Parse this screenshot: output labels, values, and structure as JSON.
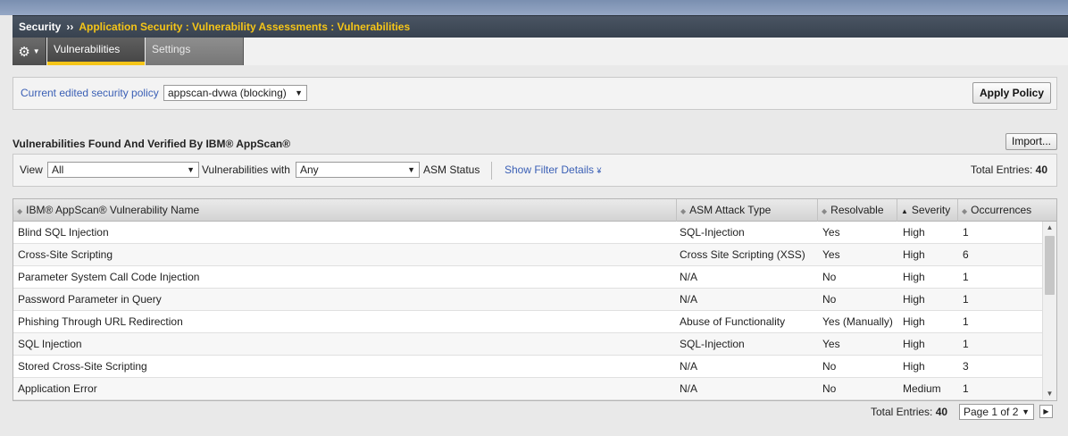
{
  "breadcrumb": {
    "root": "Security",
    "separator": "››",
    "path": "Application Security : Vulnerability Assessments : Vulnerabilities"
  },
  "tabs": [
    {
      "label": "Vulnerabilities",
      "active": true
    },
    {
      "label": "Settings",
      "active": false
    }
  ],
  "policy": {
    "label": "Current edited security policy",
    "selected": "appscan-dvwa (blocking)",
    "apply_label": "Apply Policy"
  },
  "section": {
    "title": "Vulnerabilities Found And Verified By IBM® AppScan®",
    "import_label": "Import..."
  },
  "filter": {
    "view_label": "View",
    "view_value": "All",
    "vuln_with_label": "Vulnerabilities with",
    "vuln_with_value": "Any",
    "asm_status_label": "ASM Status",
    "show_filter_label": "Show Filter Details",
    "total_label": "Total Entries:",
    "total_value": "40"
  },
  "table": {
    "columns": [
      "IBM® AppScan® Vulnerability Name",
      "ASM Attack Type",
      "Resolvable",
      "Severity",
      "Occurrences"
    ],
    "rows": [
      [
        "Blind SQL Injection",
        "SQL-Injection",
        "Yes",
        "High",
        "1"
      ],
      [
        "Cross-Site Scripting",
        "Cross Site Scripting (XSS)",
        "Yes",
        "High",
        "6"
      ],
      [
        "Parameter System Call Code Injection",
        "N/A",
        "No",
        "High",
        "1"
      ],
      [
        "Password Parameter in Query",
        "N/A",
        "No",
        "High",
        "1"
      ],
      [
        "Phishing Through URL Redirection",
        "Abuse of Functionality",
        "Yes (Manually)",
        "High",
        "1"
      ],
      [
        "SQL Injection",
        "SQL-Injection",
        "Yes",
        "High",
        "1"
      ],
      [
        "Stored Cross-Site Scripting",
        "N/A",
        "No",
        "High",
        "3"
      ],
      [
        "Application Error",
        "N/A",
        "No",
        "Medium",
        "1"
      ]
    ]
  },
  "footer": {
    "total_label": "Total Entries:",
    "total_value": "40",
    "page_value": "Page 1 of 2"
  },
  "icons": {
    "gear": "gear-icon",
    "dropdown": "chevron-down-icon",
    "sort": "sort-icon",
    "next": "next-page-icon"
  },
  "colors": {
    "title_bg": "#3f4a58",
    "accent": "#f5c518",
    "link": "#3a5fb5"
  }
}
